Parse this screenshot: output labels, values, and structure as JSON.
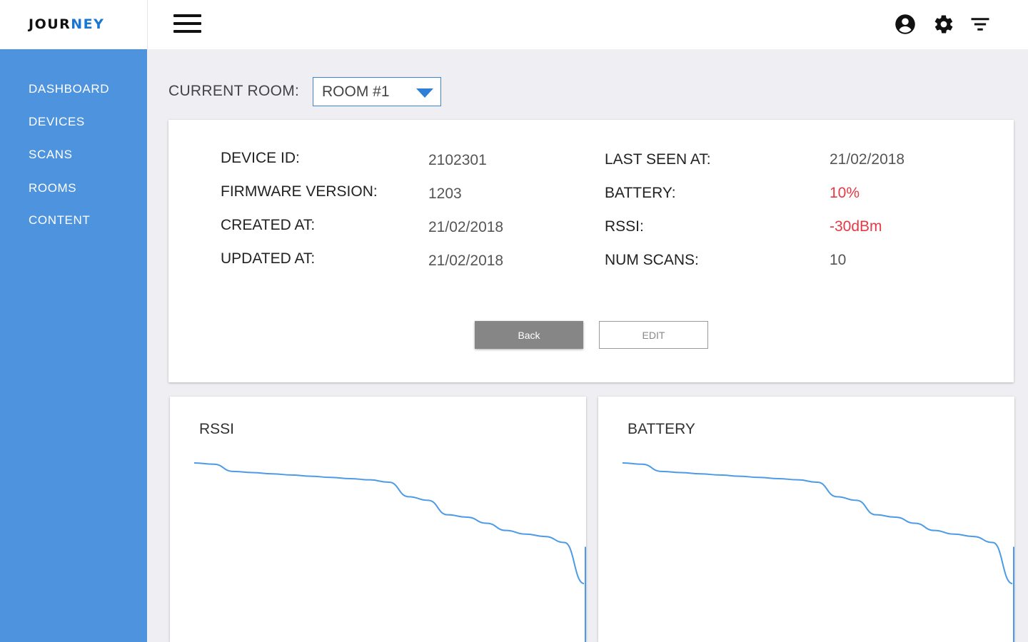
{
  "app": {
    "logo_primary": "JOUR",
    "logo_accent": "NEY",
    "accent_color": "#4d93dd",
    "brand_color": "#1976d2"
  },
  "header": {
    "icons": [
      "menu-icon",
      "account-icon",
      "settings-icon",
      "filter-icon"
    ]
  },
  "sidebar": {
    "items": [
      {
        "label": "DASHBOARD"
      },
      {
        "label": "DEVICES"
      },
      {
        "label": "SCANS"
      },
      {
        "label": "ROOMS"
      },
      {
        "label": "CONTENT"
      }
    ]
  },
  "room": {
    "label": "CURRENT ROOM:",
    "selected": "ROOM #1"
  },
  "device": {
    "left": [
      {
        "label": "DEVICE ID:",
        "value": "2102301"
      },
      {
        "label": "FIRMWARE VERSION:",
        "value": "1203"
      },
      {
        "label": "CREATED AT:",
        "value": "21/02/2018"
      },
      {
        "label": "UPDATED AT:",
        "value": "21/02/2018"
      }
    ],
    "right": [
      {
        "label": "LAST SEEN AT:",
        "value": "21/02/2018"
      },
      {
        "label": "BATTERY:",
        "value": "10%"
      },
      {
        "label": "RSSI:",
        "value": "-30dBm"
      },
      {
        "label": "NUM SCANS:",
        "value": "10"
      }
    ],
    "alert_color": "#e53945"
  },
  "buttons": {
    "back": "Back",
    "edit": "EDIT"
  },
  "chart_data": [
    {
      "type": "line",
      "title": "RSSI",
      "series": [
        {
          "values": [
            100,
            99,
            93,
            92,
            91,
            90,
            89,
            88,
            87,
            86,
            84,
            72,
            69,
            57,
            55,
            50,
            44,
            41,
            39,
            34,
            0
          ]
        }
      ],
      "grid": false,
      "color": "#4d9be6"
    },
    {
      "type": "line",
      "title": "BATTERY",
      "series": [
        {
          "values": [
            100,
            99,
            93,
            92,
            91,
            90,
            89,
            88,
            87,
            86,
            84,
            72,
            69,
            57,
            55,
            50,
            44,
            41,
            39,
            34,
            0
          ]
        }
      ],
      "grid": false,
      "color": "#4d9be6"
    }
  ]
}
